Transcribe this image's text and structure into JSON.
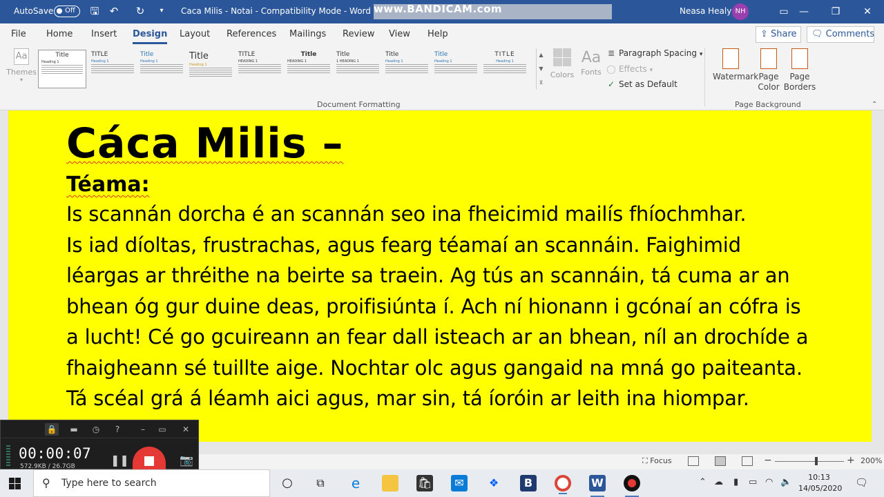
{
  "titlebar": {
    "autosave_label": "AutoSave",
    "autosave_state": "Off",
    "doc_title": "Caca Milis - Notai  -  Compatibility Mode  -  Word",
    "watermark": "www.BANDICAM.com",
    "user_name": "Neasa Healy",
    "user_initials": "NH"
  },
  "tabs": [
    "File",
    "Home",
    "Insert",
    "Design",
    "Layout",
    "References",
    "Mailings",
    "Review",
    "View",
    "Help"
  ],
  "active_tab": "Design",
  "share_label": "Share",
  "comments_label": "Comments",
  "ribbon": {
    "themes_label": "Themes",
    "styles": [
      {
        "title": "Title",
        "heading": "Heading 1"
      },
      {
        "title": "TITLE",
        "heading": "Heading 1"
      },
      {
        "title": "Title",
        "heading": "Heading 1"
      },
      {
        "title": "Title",
        "heading": "Heading 1"
      },
      {
        "title": "TITLE",
        "heading": "HEADING 1"
      },
      {
        "title": "Title",
        "heading": "HEADING 1"
      },
      {
        "title": "Title",
        "heading": "1   HEADING 1"
      },
      {
        "title": "Title",
        "heading": "Heading 1"
      },
      {
        "title": "Title",
        "heading": "Heading 1"
      },
      {
        "title": "TITLE",
        "heading": "Heading 1"
      }
    ],
    "colors_label": "Colors",
    "fonts_label": "Fonts",
    "paragraph_spacing": "Paragraph Spacing",
    "effects": "Effects",
    "set_default": "Set as Default",
    "doc_formatting_group": "Document Formatting",
    "watermark_label": "Watermark",
    "page_color_label": "Page Color",
    "page_borders_label": "Page Borders",
    "page_background_group": "Page Background"
  },
  "document": {
    "heading": "Cáca Milis –",
    "subheading": "Téama:",
    "lines": [
      "Is scannán dorcha é an scannán seo ina fheicimid mailís fhíochmhar.",
      "Is iad díoltas, frustrachas, agus fearg téamaí an scannáin.  Faighimid",
      "léargas ar thréithe na beirte sa traein.  Ag tús an scannáin, tá cuma ar an",
      "bhean óg gur duine deas, proifisiúnta í.  Ach ní hionann i gcónaí an cófra is",
      "a lucht!  Cé go gcuireann an fear dall isteach ar an bhean, níl an drochíde a",
      "fhaigheann sé tuillte aige.  Nochtar olc agus gangaid na mná go paiteanta.",
      "Tá scéal grá á léamh aici agus, mar sin, tá íoróin ar leith ina hiompar."
    ],
    "page_color": "#ffff00"
  },
  "statusbar": {
    "focus_label": "Focus",
    "zoom": "200%"
  },
  "bandicam": {
    "time": "00:00:07",
    "size": "572.9KB / 26.7GB"
  },
  "taskbar": {
    "search_placeholder": "Type here to search",
    "time": "10:13",
    "date": "14/05/2020"
  }
}
